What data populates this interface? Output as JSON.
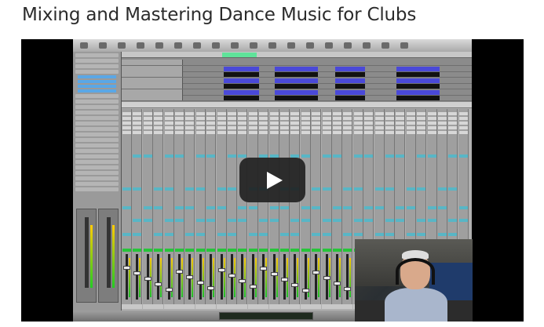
{
  "page": {
    "title": "Mixing and Mastering Dance Music for Clubs"
  },
  "video": {
    "play_icon": "play-icon",
    "play_button_color": "#1f1f1f",
    "region_color": "#4a49d8",
    "send_color": "#58b6c6",
    "loop_color": "#5fe39a"
  }
}
